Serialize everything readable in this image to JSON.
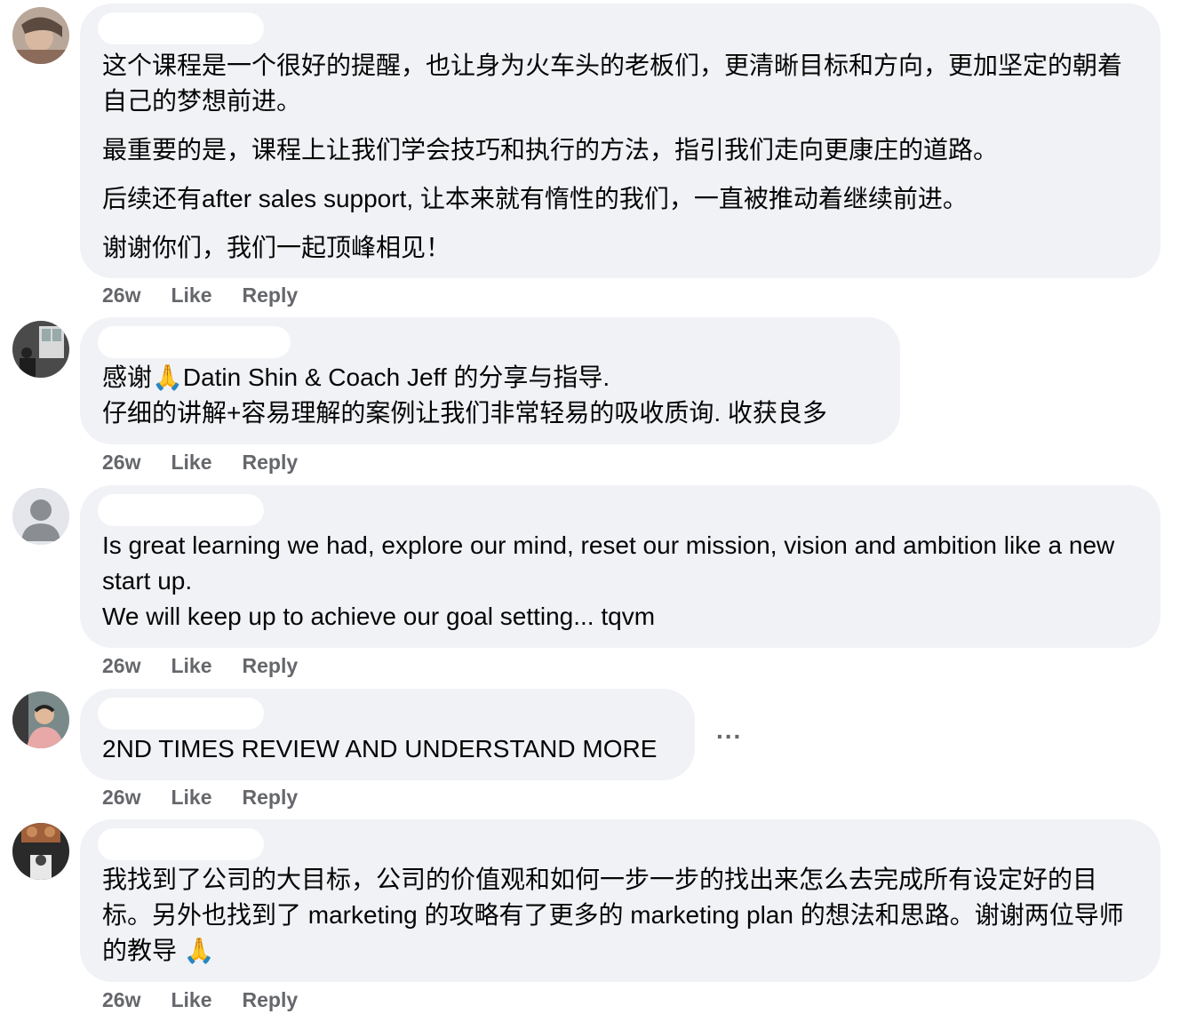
{
  "comments": [
    {
      "text": [
        "这个课程是一个很好的提醒，也让身为火车头的老板们，更清晰目标和方向，更加坚定的朝着自己的梦想前进。",
        "最重要的是，课程上让我们学会技巧和执行的方法，指引我们走向更康庄的道路。",
        "后续还有after sales support, 让本来就有惰性的我们，一直被推动着继续前进。",
        "谢谢你们，我们一起顶峰相见！"
      ],
      "time": "26w",
      "like": "Like",
      "reply": "Reply"
    },
    {
      "text": [
        "感谢🙏Datin Shin & Coach Jeff 的分享与指导.",
        "仔细的讲解+容易理解的案例让我们非常轻易的吸收质询. 收获良多"
      ],
      "time": "26w",
      "like": "Like",
      "reply": "Reply"
    },
    {
      "text": [
        "Is great learning we had, explore our mind, reset our mission, vision and ambition like a new start up.",
        "We will keep up to achieve our goal setting... tqvm"
      ],
      "time": "26w",
      "like": "Like",
      "reply": "Reply"
    },
    {
      "text": [
        "2ND TIMES REVIEW AND UNDERSTAND MORE"
      ],
      "time": "26w",
      "like": "Like",
      "reply": "Reply",
      "more": "..."
    },
    {
      "text": [
        "我找到了公司的大目标，公司的价值观和如何一步一步的找出来怎么去完成所有设定好的目标。另外也找到了 marketing 的攻略有了更多的 marketing plan 的想法和思路。谢谢两位导师的教导 🙏"
      ],
      "time": "26w",
      "like": "Like",
      "reply": "Reply"
    }
  ],
  "colors": {
    "bubble": "#f0f2f5",
    "meta": "#65676b",
    "text": "#050505"
  }
}
